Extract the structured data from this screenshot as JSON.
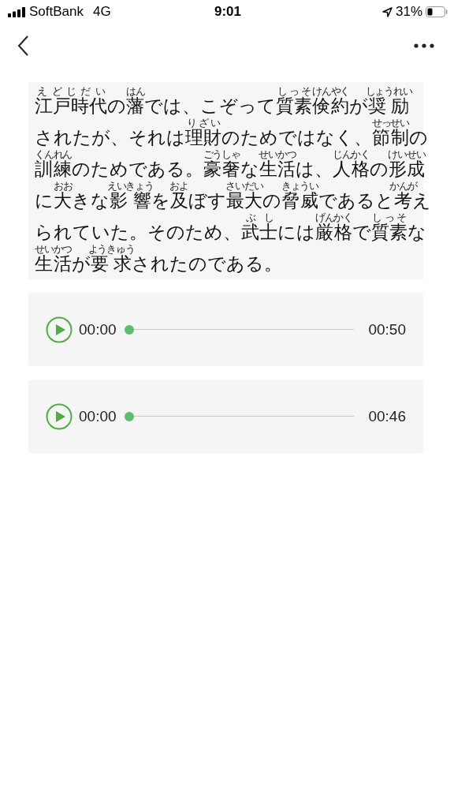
{
  "status_bar": {
    "carrier": "SoftBank",
    "network": "4G",
    "time": "9:01",
    "battery": "31%"
  },
  "passage": {
    "lines": [
      [
        {
          "text": "江戸時代",
          "ruby": "えどじだい"
        },
        {
          "text": "の"
        },
        {
          "text": "藩",
          "ruby": "はん"
        },
        {
          "text": "では、こぞって"
        },
        {
          "text": "質素",
          "ruby": "しっそ"
        },
        {
          "text": "倹約",
          "ruby": "けんやく"
        },
        {
          "text": "が"
        },
        {
          "text": "奨励",
          "ruby": "しょうれい"
        }
      ],
      [
        {
          "text": "されたが、それは"
        },
        {
          "text": "理財",
          "ruby": "りざい"
        },
        {
          "text": "のためではなく、"
        },
        {
          "text": "節制",
          "ruby": "せっせい"
        },
        {
          "text": "の"
        }
      ],
      [
        {
          "text": "訓練",
          "ruby": "くんれん"
        },
        {
          "text": "のためである。"
        },
        {
          "text": "豪奢",
          "ruby": "ごうしゃ"
        },
        {
          "text": "な"
        },
        {
          "text": "生活",
          "ruby": "せいかつ"
        },
        {
          "text": "は、"
        },
        {
          "text": "人格",
          "ruby": "じんかく"
        },
        {
          "text": "の"
        },
        {
          "text": "形成",
          "ruby": "けいせい"
        }
      ],
      [
        {
          "text": "に"
        },
        {
          "text": "大",
          "ruby": "おお"
        },
        {
          "text": "きな"
        },
        {
          "text": "影響",
          "ruby": "えいきょう"
        },
        {
          "text": "を"
        },
        {
          "text": "及",
          "ruby": "およ"
        },
        {
          "text": "ぼす"
        },
        {
          "text": "最大",
          "ruby": "さいだい"
        },
        {
          "text": "の"
        },
        {
          "text": "脅威",
          "ruby": "きょうい"
        },
        {
          "text": "であると"
        },
        {
          "text": "考",
          "ruby": "かんが"
        },
        {
          "text": "え"
        }
      ],
      [
        {
          "text": "られていた。そのため、"
        },
        {
          "text": "武士",
          "ruby": "ぶし"
        },
        {
          "text": "には"
        },
        {
          "text": "厳格",
          "ruby": "げんかく"
        },
        {
          "text": "で"
        },
        {
          "text": "質素",
          "ruby": "しっそ"
        },
        {
          "text": "な"
        }
      ],
      [
        {
          "text": "生活",
          "ruby": "せいかつ"
        },
        {
          "text": "が"
        },
        {
          "text": "要求",
          "ruby": "ようきゅう"
        },
        {
          "text": "されたのである。"
        }
      ]
    ]
  },
  "players": [
    {
      "current": "00:00",
      "duration": "00:50",
      "level": 0
    },
    {
      "current": "00:00",
      "duration": "00:46",
      "level": 0
    }
  ]
}
